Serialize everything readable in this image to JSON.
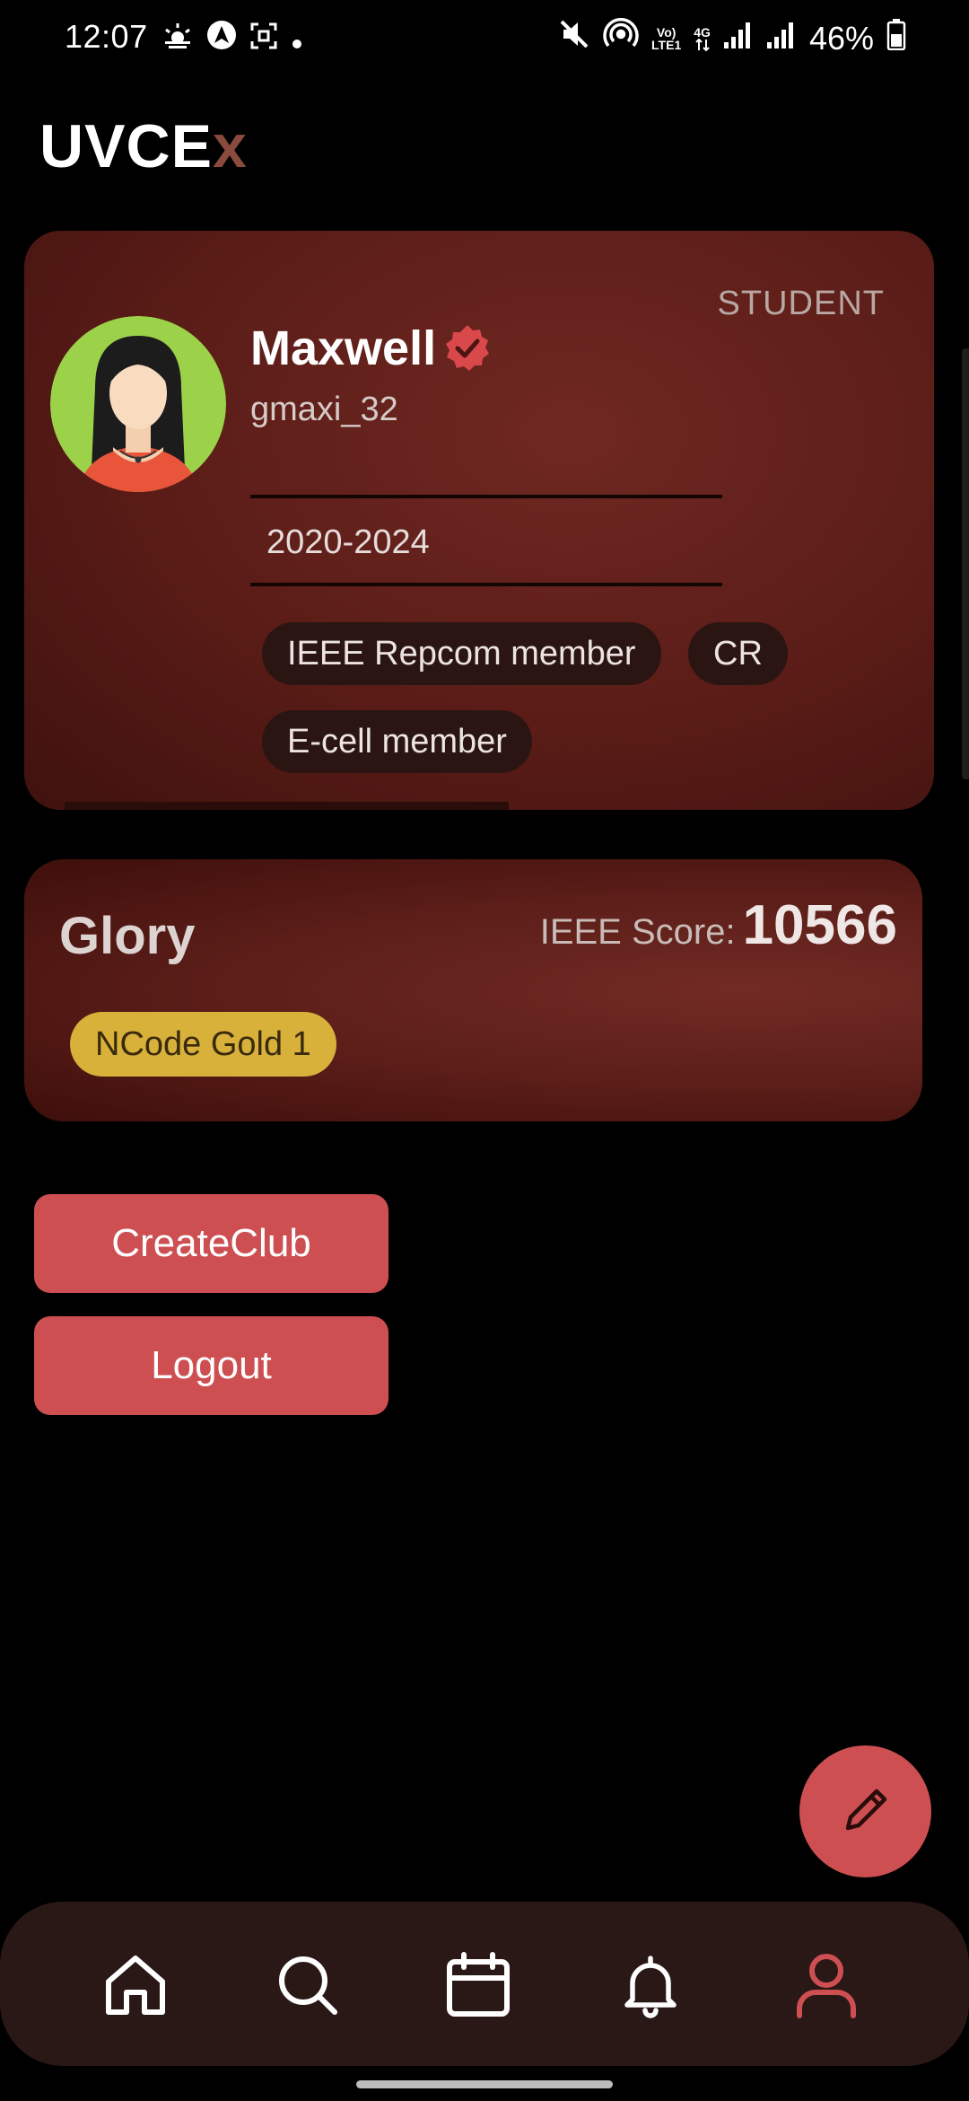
{
  "status_bar": {
    "time": "12:07",
    "battery": "46%",
    "left_icons": [
      "weather-icon",
      "navigation-icon",
      "screenshot-icon",
      "dot-icon"
    ],
    "right_icons": [
      "mute-icon",
      "hotspot-icon",
      "volte-icon",
      "data-4g-icon",
      "signal-icon",
      "signal-icon",
      "battery-icon"
    ],
    "volte_line1": "Vo)",
    "volte_line2": "LTE1",
    "data_label": "4G"
  },
  "app": {
    "title_main": "UVCE",
    "title_accent": "x"
  },
  "profile": {
    "role": "STUDENT",
    "name": "Maxwell",
    "username": "gmaxi_32",
    "year": "2020-2024",
    "tags": [
      "IEEE Repcom member",
      "CR",
      "E-cell member"
    ]
  },
  "glory": {
    "title": "Glory",
    "score_label": "IEEE Score:",
    "score_value": "10566",
    "badge": "NCode Gold 1",
    "badge_color": "#d8b13a"
  },
  "actions": {
    "create_club": "CreateClub",
    "logout": "Logout"
  },
  "colors": {
    "accent": "#cd4f52",
    "nav_bg": "#2a1816",
    "card_bg": "#5a1c17"
  },
  "nav": {
    "items": [
      "home-icon",
      "search-icon",
      "calendar-icon",
      "bell-icon",
      "profile-icon"
    ],
    "active": "profile-icon"
  },
  "fab": {
    "icon": "pencil-icon"
  }
}
